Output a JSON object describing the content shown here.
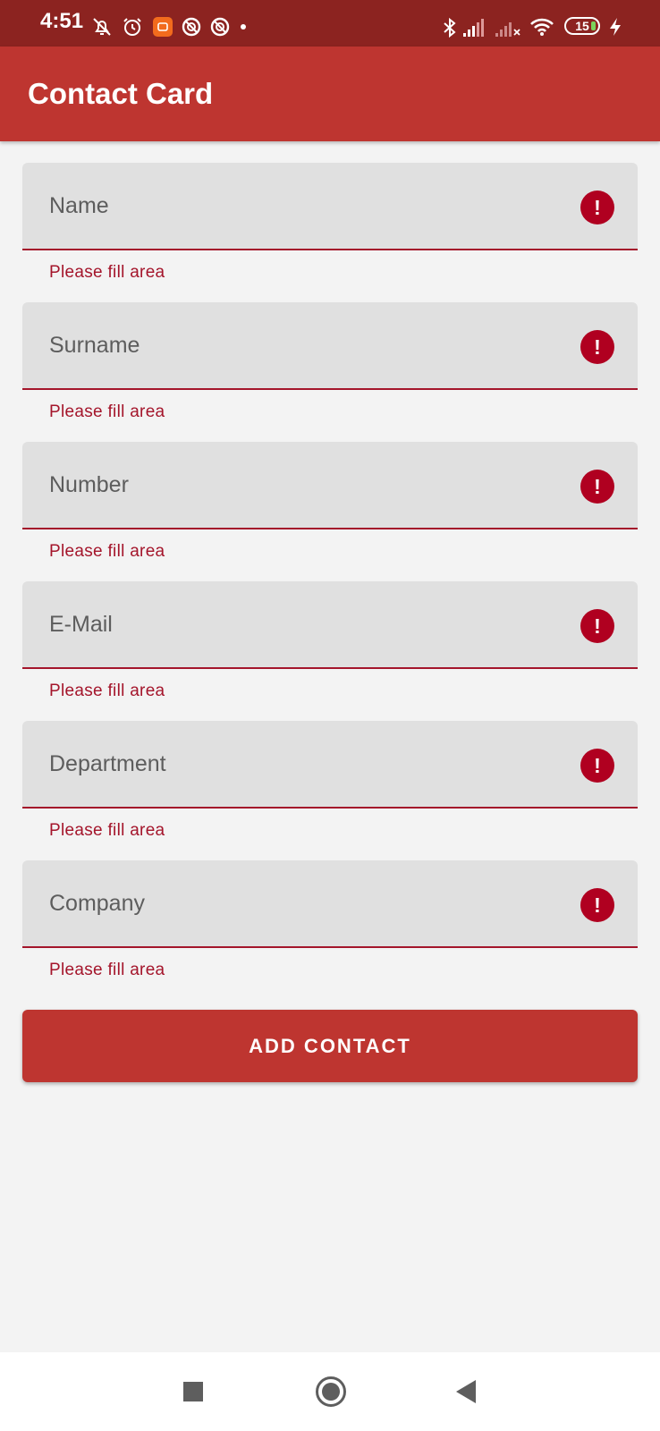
{
  "status_bar": {
    "time": "4:51",
    "battery": "15",
    "left_icons": [
      "bell-off-icon",
      "alarm-icon",
      "mi-app-icon",
      "vpn-icon",
      "vpn-icon",
      "dot-icon"
    ],
    "right_icons": [
      "bluetooth-icon",
      "signal-icon",
      "signal-x-icon",
      "wifi-icon",
      "battery-icon",
      "charging-icon"
    ]
  },
  "app_bar": {
    "title": "Contact Card"
  },
  "fields": [
    {
      "label": "Name",
      "error": "Please fill area"
    },
    {
      "label": "Surname",
      "error": "Please fill area"
    },
    {
      "label": "Number",
      "error": "Please fill area"
    },
    {
      "label": "E-Mail",
      "error": "Please fill area"
    },
    {
      "label": "Department",
      "error": "Please fill area"
    },
    {
      "label": "Company",
      "error": "Please fill area"
    }
  ],
  "error_glyph": "!",
  "add_button": {
    "label": "ADD CONTACT"
  },
  "colors": {
    "primary": "#be3530",
    "status_bar": "#8c2320",
    "error": "#a4152b",
    "field_bg": "#e0e0e0",
    "background": "#f3f3f3"
  }
}
